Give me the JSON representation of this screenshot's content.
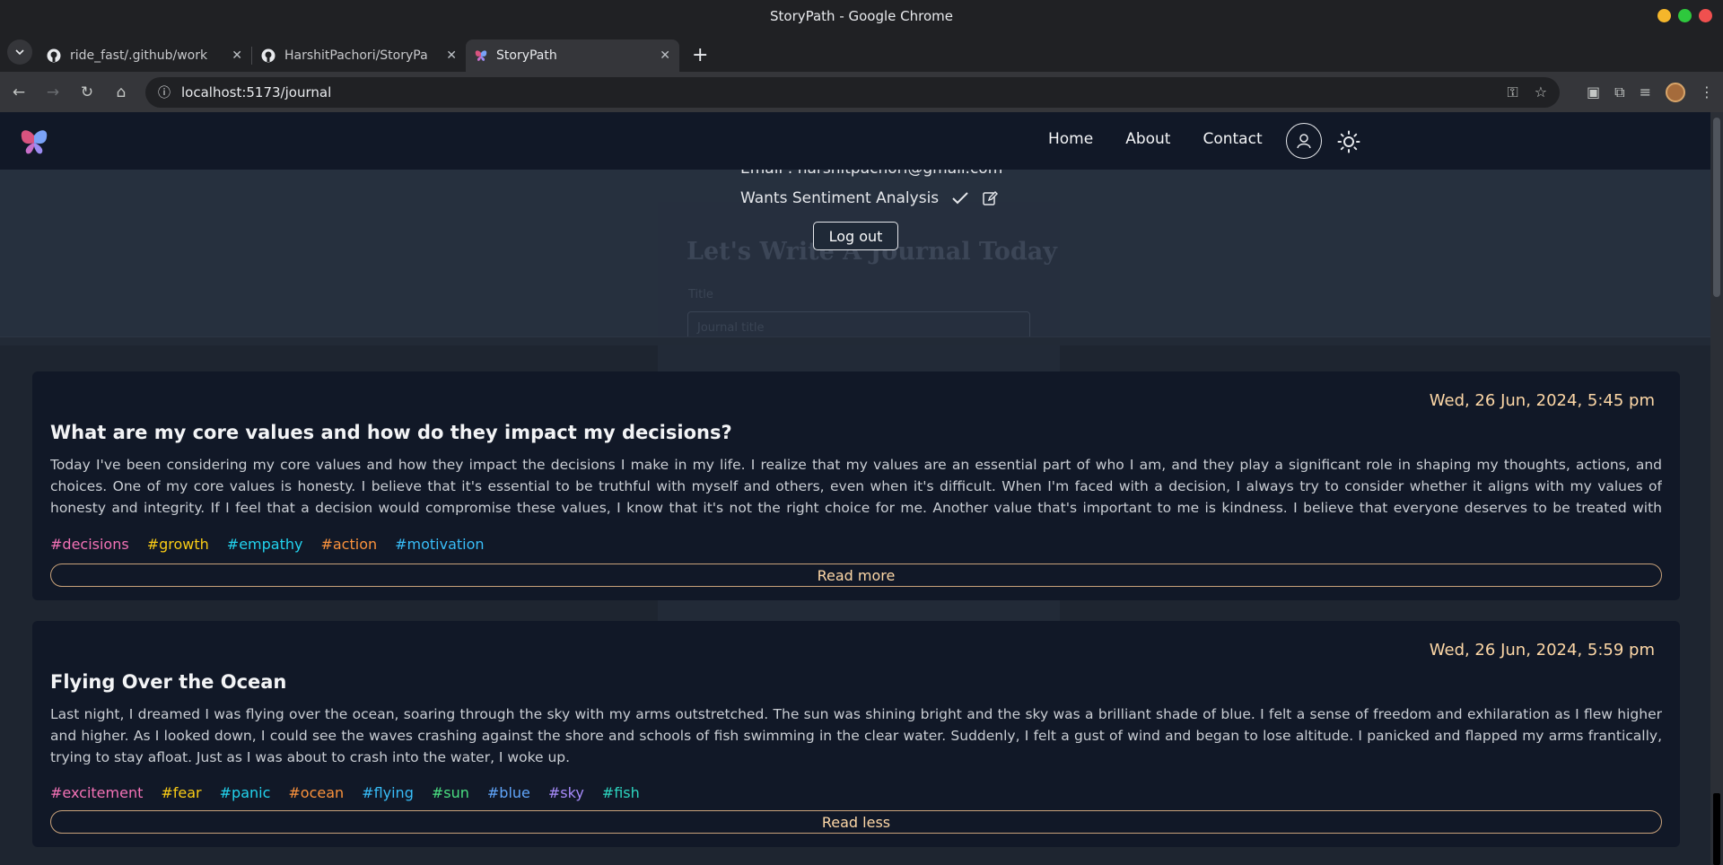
{
  "window": {
    "title": "StoryPath - Google Chrome"
  },
  "tabs": [
    {
      "label": "ride_fast/.github/work"
    },
    {
      "label": "HarshitPachori/StoryPa"
    },
    {
      "label": "StoryPath"
    }
  ],
  "address": {
    "url": "localhost:5173/journal"
  },
  "nav": {
    "links": [
      "Home",
      "About",
      "Contact"
    ]
  },
  "profile": {
    "email_label": "Email : harshitpachori@gmail.com",
    "sentiment_label": "Wants Sentiment Analysis",
    "logout_label": "Log out"
  },
  "form_ghost": {
    "heading": "Let's Write A Journal Today",
    "title_label": "Title",
    "title_placeholder": "Journal title"
  },
  "journals": [
    {
      "date": "Wed, 26 Jun, 2024, 5:45 pm",
      "title": "What are my core values and how do they impact my decisions?",
      "body": "Today I've been considering my core values and how they impact the decisions I make in my life. I realize that my values are an essential part of who I am, and they play a significant role in shaping my thoughts, actions, and choices. One of my core values is honesty. I believe that it's essential to be truthful with myself and others, even when it's difficult. When I'm faced with a decision, I always try to consider whether it aligns with my values of honesty and integrity. If I feel that a decision would compromise these values, I know that it's not the right choice for me. Another value that's important to me is kindness. I believe that everyone deserves to be treated with respect and compassion, regardless of their background or circumstances. When I'm making a decision, I try to consider how it will impact others and whether it aligns with my values of kindness and empathy. Finally, I value personal growth and self-improvement. I believe that",
      "tags": [
        "#decisions",
        "#growth",
        "#empathy",
        "#action",
        "#motivation"
      ],
      "button": "Read more"
    },
    {
      "date": "Wed, 26 Jun, 2024, 5:59 pm",
      "title": "Flying Over the Ocean",
      "body": "Last night, I dreamed I was flying over the ocean, soaring through the sky with my arms outstretched. The sun was shining bright and the sky was a brilliant shade of blue. I felt a sense of freedom and exhilaration as I flew higher and higher. As I looked down, I could see the waves crashing against the shore and schools of fish swimming in the clear water. Suddenly, I felt a gust of wind and began to lose altitude. I panicked and flapped my arms frantically, trying to stay afloat. Just as I was about to crash into the water, I woke up.",
      "tags": [
        "#excitement",
        "#fear",
        "#panic",
        "#ocean",
        "#flying",
        "#sun",
        "#blue",
        "#sky",
        "#fish"
      ],
      "button": "Read less"
    }
  ],
  "tag_colors": [
    "#f472b6",
    "#facc15",
    "#22d3ee",
    "#fb923c",
    "#38bdf8",
    "#4ade80",
    "#60a5fa",
    "#a78bfa",
    "#2dd4bf"
  ],
  "icons": {
    "tab_menu": "chevron-down-icon",
    "github": "github-icon",
    "butterfly": "butterfly-logo-icon",
    "user": "user-icon",
    "theme": "sun-icon",
    "check": "check-icon",
    "edit": "edit-icon"
  }
}
